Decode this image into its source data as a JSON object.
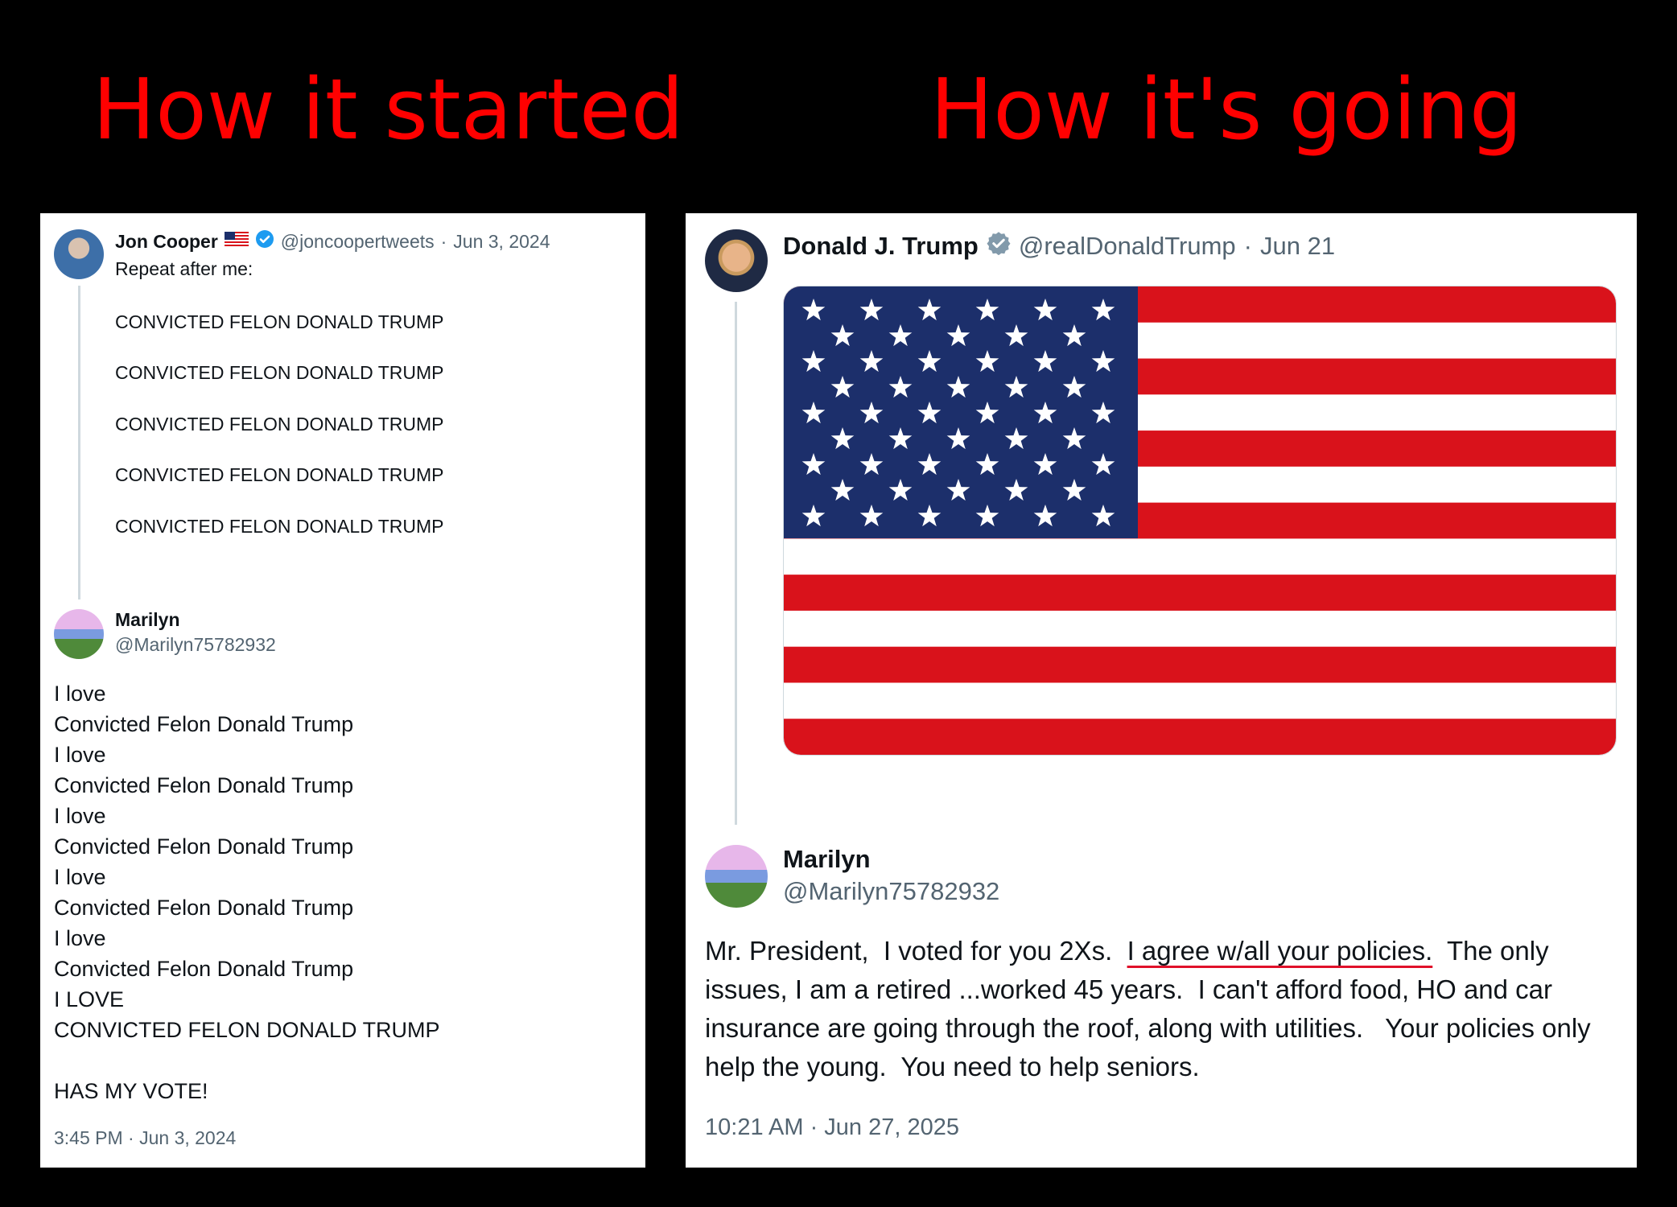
{
  "headings": {
    "left": "How it started",
    "right": "How it's going"
  },
  "colors": {
    "heading": "#ff0000",
    "verified_blue": "#1d9bf0",
    "verified_gray": "#829aab",
    "underline_red": "#e0112a",
    "flag_red": "#d9121b",
    "flag_blue": "#1c2f6b"
  },
  "left_post": {
    "author_name": "Jon Cooper",
    "author_flag_icon": "us-flag-emoji",
    "verified_icon": "blue-verified-badge",
    "author_handle": "@joncoopertweets",
    "separator": "·",
    "date": "Jun 3, 2024",
    "text_intro": "Repeat after me:",
    "repeated_lines": [
      "CONVICTED FELON DONALD TRUMP",
      "CONVICTED FELON DONALD TRUMP",
      "CONVICTED FELON DONALD TRUMP",
      "CONVICTED FELON DONALD TRUMP",
      "CONVICTED FELON DONALD TRUMP"
    ],
    "reply": {
      "name": "Marilyn",
      "handle": "@Marilyn75782932",
      "lines": [
        "I love",
        "Convicted Felon Donald Trump",
        "I love",
        "Convicted Felon Donald Trump",
        "I love",
        "Convicted Felon Donald Trump",
        "I love",
        "Convicted Felon Donald Trump",
        "I love",
        "Convicted Felon Donald Trump",
        "I LOVE",
        "CONVICTED FELON DONALD TRUMP",
        "HAS MY VOTE!"
      ],
      "timestamp": "3:45 PM · Jun 3, 2024"
    }
  },
  "right_post": {
    "author_name": "Donald J. Trump",
    "verified_icon": "gray-verified-badge",
    "author_handle": "@realDonaldTrump",
    "separator": "·",
    "date": "Jun 21",
    "media_icon": "american-flag-image",
    "reply": {
      "name": "Marilyn",
      "handle": "@Marilyn75782932",
      "text_before": "Mr. President,  I voted for you 2Xs.  ",
      "text_highlight": "I agree w/all your policies.",
      "text_after": "  The only issues, I am a retired ...worked 45 years.  I can't afford food, HO and car insurance are going through the roof, along with utilities.   Your policies only help the young.  You need to help seniors.",
      "timestamp": "10:21 AM · Jun 27, 2025"
    }
  }
}
